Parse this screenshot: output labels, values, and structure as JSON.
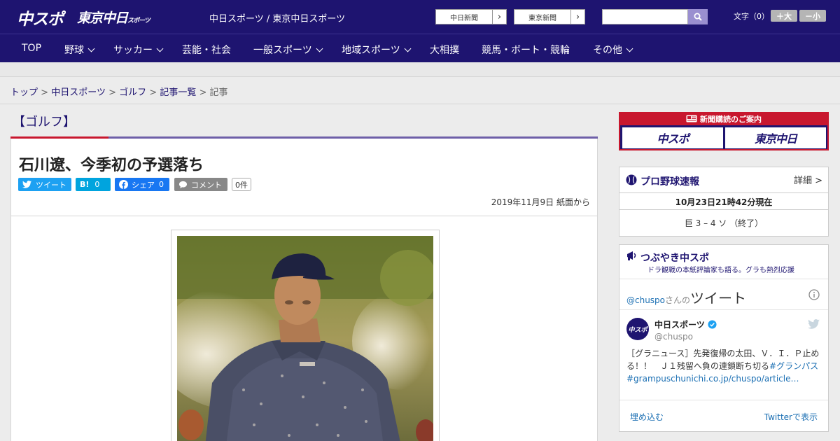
{
  "header": {
    "logo_primary": "中スポ",
    "logo_secondary": "東京中日",
    "logo_secondary_small": "スポーツ",
    "site_name": "中日スポーツ / 東京中日スポーツ",
    "paper_buttons": [
      {
        "label": "中日新聞"
      },
      {
        "label": "東京新聞"
      }
    ],
    "search_placeholder": "",
    "font_size_label": "文字（0）",
    "font_plus": "＋大",
    "font_minus": "－小"
  },
  "nav": {
    "items": [
      {
        "label": "TOP",
        "dropdown": false
      },
      {
        "label": "野球",
        "dropdown": true
      },
      {
        "label": "サッカー",
        "dropdown": true
      },
      {
        "label": "芸能・社会",
        "dropdown": false
      },
      {
        "label": "一般スポーツ",
        "dropdown": true
      },
      {
        "label": "地域スポーツ",
        "dropdown": true
      },
      {
        "label": "大相撲",
        "dropdown": false
      },
      {
        "label": "競馬・ボート・競輪",
        "dropdown": false
      },
      {
        "label": "その他",
        "dropdown": true
      }
    ]
  },
  "breadcrumb": {
    "items": [
      "トップ",
      "中日スポーツ",
      "ゴルフ",
      "記事一覧"
    ],
    "current": "記事",
    "separator": ">"
  },
  "article": {
    "category": "【ゴルフ】",
    "title": "石川遼、今季初の予選落ち",
    "share": {
      "tweet_label": "ツイート",
      "hatena_label": "B!",
      "hatena_count": "0",
      "facebook_label": "シェア",
      "facebook_count": "0",
      "comment_label": "コメント",
      "comment_count": "0件"
    },
    "date": "2019年11月9日 紙面から",
    "photo_icon": "golfer-photo"
  },
  "sidebar": {
    "subscribe_banner": {
      "title": "新聞購読のご案内",
      "logo_left": "中スポ",
      "logo_right": "東京中日"
    },
    "baseball": {
      "title": "プロ野球速報",
      "detail_link": "詳細 >",
      "updated": "10月23日21時42分現在",
      "score": "巨 3 – 4 ソ （終了）"
    },
    "tweets": {
      "title": "つぶやき中スポ",
      "subtitle": "ドラ観戦の本紙評論家も語る。グラも熱烈応援",
      "handle_line_prefix": "@chuspo",
      "handle_line_mid": "さんの",
      "handle_line_suffix": "ツイート",
      "account_name": "中日スポーツ",
      "account_handle": "@chuspo",
      "tweet_text": "［グラニュース］先発復帰の太田、Ｖ．Ｉ．Ｐ止める！！　Ｊ１残留へ負の連鎖断ち切る",
      "tweet_hashtag": "#グランパス",
      "tweet_link": "#grampuschunichi.co.jp/chuspo/article…",
      "embed_label": "埋め込む",
      "view_on_twitter": "Twitterで表示"
    }
  },
  "colors": {
    "brand_navy": "#1e1470",
    "accent_red": "#c8172e",
    "twitter_blue": "#1da1f2",
    "hatena_blue": "#00a4de",
    "facebook_blue": "#1877f2"
  }
}
